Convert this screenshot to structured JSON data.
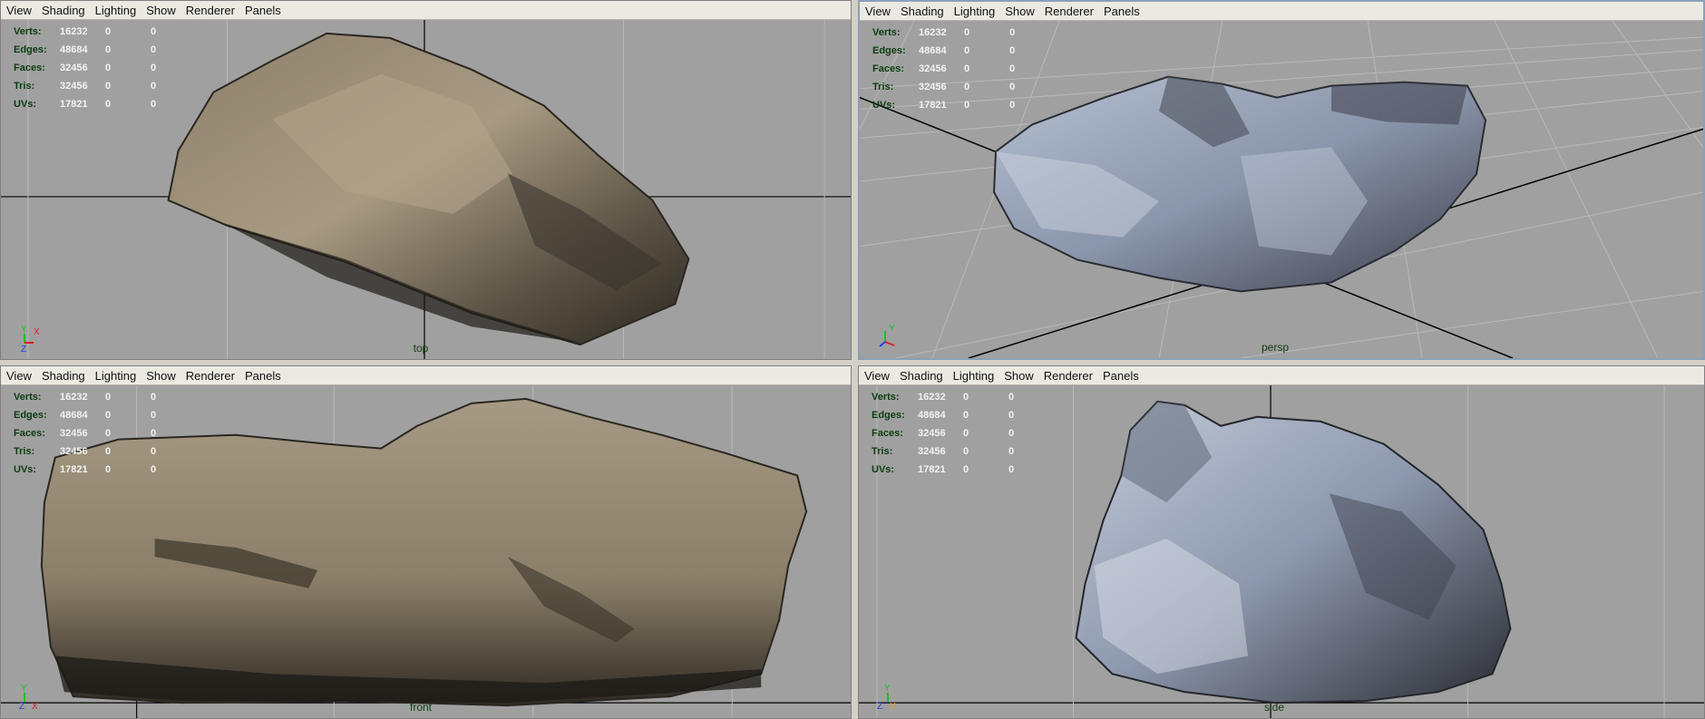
{
  "menu": [
    "View",
    "Shading",
    "Lighting",
    "Show",
    "Renderer",
    "Panels"
  ],
  "stats": {
    "labels": [
      "Verts:",
      "Edges:",
      "Faces:",
      "Tris:",
      "UVs:"
    ],
    "values": [
      "16232",
      "48684",
      "32456",
      "32456",
      "17821"
    ],
    "zero": "0"
  },
  "panels": {
    "top": {
      "camera": "top"
    },
    "persp": {
      "camera": "persp"
    },
    "front": {
      "camera": "front"
    },
    "side": {
      "camera": "side"
    }
  },
  "axes": {
    "x": "X",
    "y": "Y",
    "z": "Z",
    "color_x": "#e02020",
    "color_y": "#20c020",
    "color_z": "#2040e0",
    "color_orange": "#e0a020"
  },
  "colors": {
    "viewport_bg": "#a0a0a0",
    "menubar_bg": "#ece9e2",
    "grid_line": "#b4b4b4",
    "axis_line": "#000000",
    "rock_brown": "#6e5e48",
    "rock_blue": "#8a94a8"
  }
}
